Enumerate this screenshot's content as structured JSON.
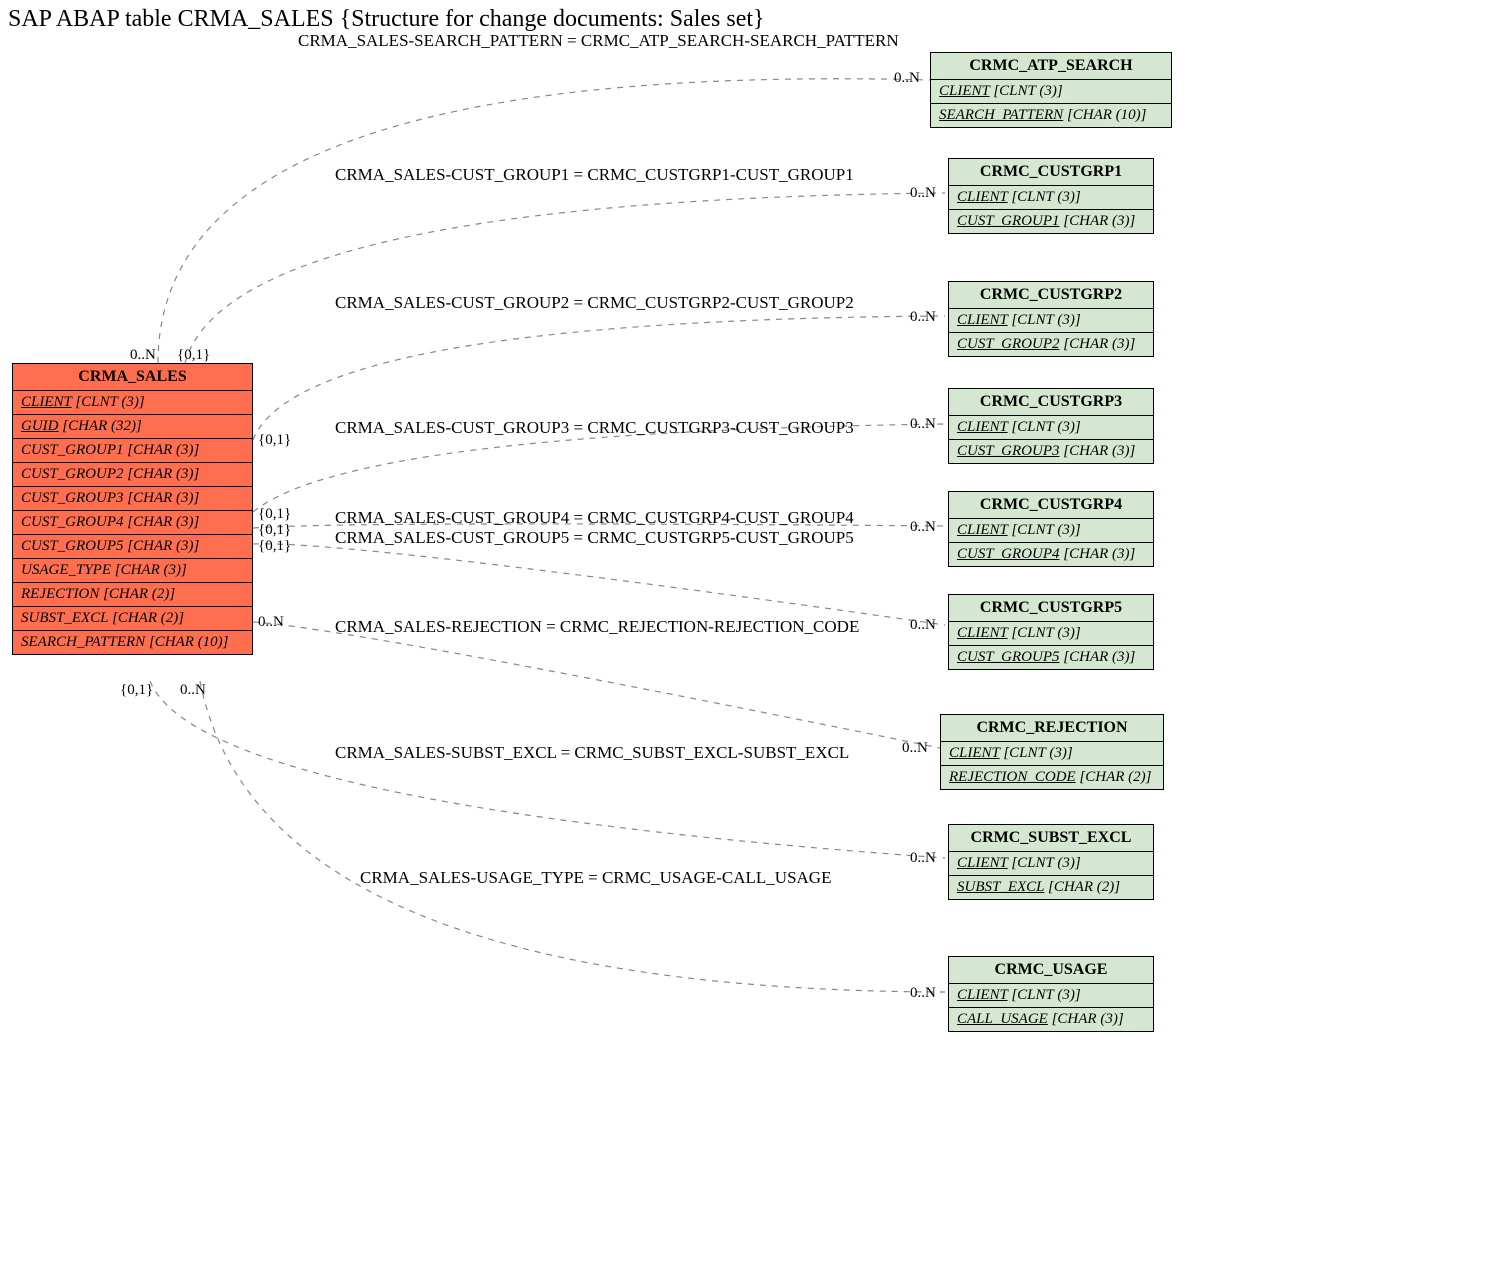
{
  "title": "SAP ABAP table CRMA_SALES {Structure for change documents: Sales set}",
  "main_entity": {
    "name": "CRMA_SALES",
    "fields": [
      {
        "label": "CLIENT",
        "type": "[CLNT (3)]",
        "underline": true
      },
      {
        "label": "GUID",
        "type": "[CHAR (32)]",
        "underline": true
      },
      {
        "label": "CUST_GROUP1",
        "type": "[CHAR (3)]",
        "underline": false
      },
      {
        "label": "CUST_GROUP2",
        "type": "[CHAR (3)]",
        "underline": false
      },
      {
        "label": "CUST_GROUP3",
        "type": "[CHAR (3)]",
        "underline": false
      },
      {
        "label": "CUST_GROUP4",
        "type": "[CHAR (3)]",
        "underline": false
      },
      {
        "label": "CUST_GROUP5",
        "type": "[CHAR (3)]",
        "underline": false
      },
      {
        "label": "USAGE_TYPE",
        "type": "[CHAR (3)]",
        "underline": false
      },
      {
        "label": "REJECTION",
        "type": "[CHAR (2)]",
        "underline": false
      },
      {
        "label": "SUBST_EXCL",
        "type": "[CHAR (2)]",
        "underline": false
      },
      {
        "label": "SEARCH_PATTERN",
        "type": "[CHAR (10)]",
        "underline": false
      }
    ]
  },
  "ref_entities": [
    {
      "name": "CRMC_ATP_SEARCH",
      "f1": {
        "label": "CLIENT",
        "type": "[CLNT (3)]",
        "u": true
      },
      "f2": {
        "label": "SEARCH_PATTERN",
        "type": "[CHAR (10)]",
        "u": true
      }
    },
    {
      "name": "CRMC_CUSTGRP1",
      "f1": {
        "label": "CLIENT",
        "type": "[CLNT (3)]",
        "u": true
      },
      "f2": {
        "label": "CUST_GROUP1",
        "type": "[CHAR (3)]",
        "u": true
      }
    },
    {
      "name": "CRMC_CUSTGRP2",
      "f1": {
        "label": "CLIENT",
        "type": "[CLNT (3)]",
        "u": true
      },
      "f2": {
        "label": "CUST_GROUP2",
        "type": "[CHAR (3)]",
        "u": true
      }
    },
    {
      "name": "CRMC_CUSTGRP3",
      "f1": {
        "label": "CLIENT",
        "type": "[CLNT (3)]",
        "u": true
      },
      "f2": {
        "label": "CUST_GROUP3",
        "type": "[CHAR (3)]",
        "u": true
      }
    },
    {
      "name": "CRMC_CUSTGRP4",
      "f1": {
        "label": "CLIENT",
        "type": "[CLNT (3)]",
        "u": true
      },
      "f2": {
        "label": "CUST_GROUP4",
        "type": "[CHAR (3)]",
        "u": true
      }
    },
    {
      "name": "CRMC_CUSTGRP5",
      "f1": {
        "label": "CLIENT",
        "type": "[CLNT (3)]",
        "u": true
      },
      "f2": {
        "label": "CUST_GROUP5",
        "type": "[CHAR (3)]",
        "u": true
      }
    },
    {
      "name": "CRMC_REJECTION",
      "f1": {
        "label": "CLIENT",
        "type": "[CLNT (3)]",
        "u": true
      },
      "f2": {
        "label": "REJECTION_CODE",
        "type": "[CHAR (2)]",
        "u": true
      }
    },
    {
      "name": "CRMC_SUBST_EXCL",
      "f1": {
        "label": "CLIENT",
        "type": "[CLNT (3)]",
        "u": true
      },
      "f2": {
        "label": "SUBST_EXCL",
        "type": "[CHAR (2)]",
        "u": true
      }
    },
    {
      "name": "CRMC_USAGE",
      "f1": {
        "label": "CLIENT",
        "type": "[CLNT (3)]",
        "u": true
      },
      "f2": {
        "label": "CALL_USAGE",
        "type": "[CHAR (3)]",
        "u": true
      }
    }
  ],
  "relations": [
    "CRMA_SALES-SEARCH_PATTERN = CRMC_ATP_SEARCH-SEARCH_PATTERN",
    "CRMA_SALES-CUST_GROUP1 = CRMC_CUSTGRP1-CUST_GROUP1",
    "CRMA_SALES-CUST_GROUP2 = CRMC_CUSTGRP2-CUST_GROUP2",
    "CRMA_SALES-CUST_GROUP3 = CRMC_CUSTGRP3-CUST_GROUP3",
    "CRMA_SALES-CUST_GROUP4 = CRMC_CUSTGRP4-CUST_GROUP4",
    "CRMA_SALES-CUST_GROUP5 = CRMC_CUSTGRP5-CUST_GROUP5",
    "CRMA_SALES-REJECTION = CRMC_REJECTION-REJECTION_CODE",
    "CRMA_SALES-SUBST_EXCL = CRMC_SUBST_EXCL-SUBST_EXCL",
    "CRMA_SALES-USAGE_TYPE = CRMC_USAGE-CALL_USAGE"
  ],
  "left_card": {
    "top_0n": "0..N",
    "top_01": "{0,1}",
    "mid_01_a": "{0,1}",
    "mid_01_b": "{0,1}",
    "mid_01_c": "{0,1}",
    "mid_01_d": "{0,1}",
    "mid_0n": "0..N",
    "bot_01": "{0,1}",
    "bot_0n": "0..N"
  },
  "right_card": "0..N"
}
